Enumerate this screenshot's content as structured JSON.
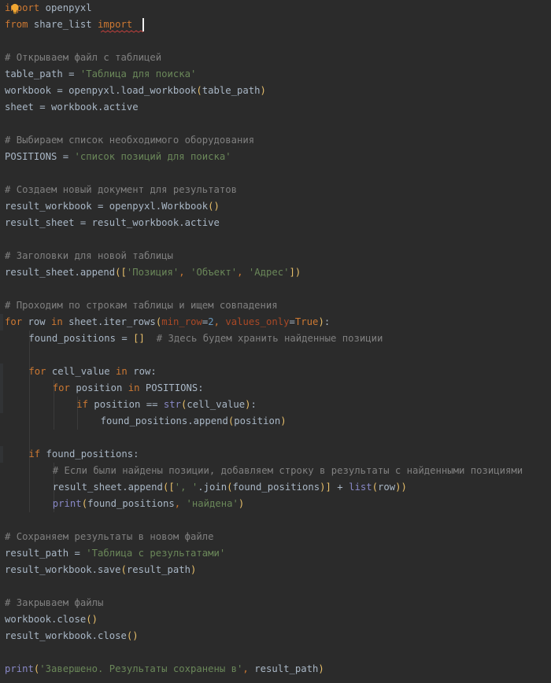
{
  "colors": {
    "background": "#2B2B2B",
    "default": "#A9B7C6",
    "keyword": "#CC7832",
    "string": "#6A8759",
    "comment": "#808080",
    "number": "#6897BB",
    "builtin": "#8888C6",
    "param": "#AA4926",
    "bracket": "#E8BF6A",
    "warning": "#BC3F3C",
    "bulb": "#F0A732"
  },
  "icons": {
    "intention_bulb": "lightbulb-icon"
  },
  "lines": [
    {
      "indent": 0,
      "tokens": [
        {
          "t": "import",
          "k": "keyword"
        },
        {
          "t": " openpyxl",
          "k": "default"
        }
      ]
    },
    {
      "indent": 0,
      "tokens": [
        {
          "t": "from",
          "k": "keyword"
        },
        {
          "t": " share_list ",
          "k": "default"
        },
        {
          "t": "import",
          "k": "keyword"
        }
      ]
    },
    {
      "indent": 0,
      "tokens": []
    },
    {
      "indent": 0,
      "tokens": [
        {
          "t": "# Открываем файл с таблицей",
          "k": "comment"
        }
      ]
    },
    {
      "indent": 0,
      "tokens": [
        {
          "t": "table_path = ",
          "k": "default"
        },
        {
          "t": "'Таблица для поиска'",
          "k": "string"
        }
      ]
    },
    {
      "indent": 0,
      "tokens": [
        {
          "t": "workbook = openpyxl.load_workbook",
          "k": "default"
        },
        {
          "t": "(",
          "k": "bracket"
        },
        {
          "t": "table_path",
          "k": "default"
        },
        {
          "t": ")",
          "k": "bracket"
        }
      ]
    },
    {
      "indent": 0,
      "tokens": [
        {
          "t": "sheet = workbook.active",
          "k": "default"
        }
      ]
    },
    {
      "indent": 0,
      "tokens": []
    },
    {
      "indent": 0,
      "tokens": [
        {
          "t": "# Выбираем список необходимого оборудования",
          "k": "comment"
        }
      ]
    },
    {
      "indent": 0,
      "tokens": [
        {
          "t": "POSITIONS = ",
          "k": "default"
        },
        {
          "t": "'список позиций для поиска'",
          "k": "string"
        }
      ]
    },
    {
      "indent": 0,
      "tokens": []
    },
    {
      "indent": 0,
      "tokens": [
        {
          "t": "# Создаем новый документ для результатов",
          "k": "comment"
        }
      ]
    },
    {
      "indent": 0,
      "tokens": [
        {
          "t": "result_workbook = openpyxl.Workbook",
          "k": "default"
        },
        {
          "t": "()",
          "k": "bracket"
        }
      ]
    },
    {
      "indent": 0,
      "tokens": [
        {
          "t": "result_sheet = result_workbook.active",
          "k": "default"
        }
      ]
    },
    {
      "indent": 0,
      "tokens": []
    },
    {
      "indent": 0,
      "tokens": [
        {
          "t": "# Заголовки для новой таблицы",
          "k": "comment"
        }
      ]
    },
    {
      "indent": 0,
      "tokens": [
        {
          "t": "result_sheet.append",
          "k": "default"
        },
        {
          "t": "([",
          "k": "bracket"
        },
        {
          "t": "'Позиция'",
          "k": "string"
        },
        {
          "t": ", ",
          "k": "keyword"
        },
        {
          "t": "'Объект'",
          "k": "string"
        },
        {
          "t": ", ",
          "k": "keyword"
        },
        {
          "t": "'Адрес'",
          "k": "string"
        },
        {
          "t": "])",
          "k": "bracket"
        }
      ]
    },
    {
      "indent": 0,
      "tokens": []
    },
    {
      "indent": 0,
      "tokens": [
        {
          "t": "# Проходим по строкам таблицы и ищем совпадения",
          "k": "comment"
        }
      ]
    },
    {
      "indent": 0,
      "tokens": [
        {
          "t": "for",
          "k": "keyword"
        },
        {
          "t": " row ",
          "k": "default"
        },
        {
          "t": "in",
          "k": "keyword"
        },
        {
          "t": " sheet.iter_rows",
          "k": "default"
        },
        {
          "t": "(",
          "k": "bracket"
        },
        {
          "t": "min_row",
          "k": "param"
        },
        {
          "t": "=",
          "k": "default"
        },
        {
          "t": "2",
          "k": "number"
        },
        {
          "t": ", ",
          "k": "keyword"
        },
        {
          "t": "values_only",
          "k": "param"
        },
        {
          "t": "=",
          "k": "default"
        },
        {
          "t": "True",
          "k": "keyword"
        },
        {
          "t": ")",
          "k": "bracket"
        },
        {
          "t": ":",
          "k": "default"
        }
      ]
    },
    {
      "indent": 1,
      "tokens": [
        {
          "t": "found_positions = ",
          "k": "default"
        },
        {
          "t": "[]",
          "k": "bracket"
        },
        {
          "t": "  ",
          "k": "default"
        },
        {
          "t": "# Здесь будем хранить найденные позиции",
          "k": "comment"
        }
      ]
    },
    {
      "indent": 0,
      "tokens": []
    },
    {
      "indent": 1,
      "tokens": [
        {
          "t": "for",
          "k": "keyword"
        },
        {
          "t": " cell_value ",
          "k": "default"
        },
        {
          "t": "in",
          "k": "keyword"
        },
        {
          "t": " row:",
          "k": "default"
        }
      ]
    },
    {
      "indent": 2,
      "tokens": [
        {
          "t": "for",
          "k": "keyword"
        },
        {
          "t": " position ",
          "k": "default"
        },
        {
          "t": "in",
          "k": "keyword"
        },
        {
          "t": " POSITIONS:",
          "k": "default"
        }
      ]
    },
    {
      "indent": 3,
      "tokens": [
        {
          "t": "if",
          "k": "keyword"
        },
        {
          "t": " position == ",
          "k": "default"
        },
        {
          "t": "str",
          "k": "builtin"
        },
        {
          "t": "(",
          "k": "bracket"
        },
        {
          "t": "cell_value",
          "k": "default"
        },
        {
          "t": ")",
          "k": "bracket"
        },
        {
          "t": ":",
          "k": "default"
        }
      ]
    },
    {
      "indent": 4,
      "tokens": [
        {
          "t": "found_positions.append",
          "k": "default"
        },
        {
          "t": "(",
          "k": "bracket"
        },
        {
          "t": "position",
          "k": "default"
        },
        {
          "t": ")",
          "k": "bracket"
        }
      ]
    },
    {
      "indent": 0,
      "tokens": []
    },
    {
      "indent": 1,
      "tokens": [
        {
          "t": "if",
          "k": "keyword"
        },
        {
          "t": " found_positions:",
          "k": "default"
        }
      ]
    },
    {
      "indent": 2,
      "tokens": [
        {
          "t": "# Если были найдены позиции, добавляем строку в результаты с найденными позициями",
          "k": "comment"
        }
      ]
    },
    {
      "indent": 2,
      "tokens": [
        {
          "t": "result_sheet.append",
          "k": "default"
        },
        {
          "t": "([",
          "k": "bracket"
        },
        {
          "t": "', '",
          "k": "string"
        },
        {
          "t": ".join",
          "k": "default"
        },
        {
          "t": "(",
          "k": "bracket"
        },
        {
          "t": "found_positions",
          "k": "default"
        },
        {
          "t": ")",
          "k": "bracket"
        },
        {
          "t": "]",
          "k": "bracket"
        },
        {
          "t": " + ",
          "k": "default"
        },
        {
          "t": "list",
          "k": "builtin"
        },
        {
          "t": "(",
          "k": "bracket"
        },
        {
          "t": "row",
          "k": "default"
        },
        {
          "t": "))",
          "k": "bracket"
        }
      ]
    },
    {
      "indent": 2,
      "tokens": [
        {
          "t": "print",
          "k": "builtin"
        },
        {
          "t": "(",
          "k": "bracket"
        },
        {
          "t": "found_positions",
          "k": "default"
        },
        {
          "t": ", ",
          "k": "keyword"
        },
        {
          "t": "'найдена'",
          "k": "string"
        },
        {
          "t": ")",
          "k": "bracket"
        }
      ]
    },
    {
      "indent": 0,
      "tokens": []
    },
    {
      "indent": 0,
      "tokens": [
        {
          "t": "# Сохраняем результаты в новом файле",
          "k": "comment"
        }
      ]
    },
    {
      "indent": 0,
      "tokens": [
        {
          "t": "result_path = ",
          "k": "default"
        },
        {
          "t": "'Таблица с результатами'",
          "k": "string"
        }
      ]
    },
    {
      "indent": 0,
      "tokens": [
        {
          "t": "result_workbook.save",
          "k": "default"
        },
        {
          "t": "(",
          "k": "bracket"
        },
        {
          "t": "result_path",
          "k": "default"
        },
        {
          "t": ")",
          "k": "bracket"
        }
      ]
    },
    {
      "indent": 0,
      "tokens": []
    },
    {
      "indent": 0,
      "tokens": [
        {
          "t": "# Закрываем файлы",
          "k": "comment"
        }
      ]
    },
    {
      "indent": 0,
      "tokens": [
        {
          "t": "workbook.close",
          "k": "default"
        },
        {
          "t": "()",
          "k": "bracket"
        }
      ]
    },
    {
      "indent": 0,
      "tokens": [
        {
          "t": "result_workbook.close",
          "k": "default"
        },
        {
          "t": "()",
          "k": "bracket"
        }
      ]
    },
    {
      "indent": 0,
      "tokens": []
    },
    {
      "indent": 0,
      "tokens": [
        {
          "t": "print",
          "k": "builtin"
        },
        {
          "t": "(",
          "k": "bracket"
        },
        {
          "t": "'Завершено. Результаты сохранены в'",
          "k": "string"
        },
        {
          "t": ", ",
          "k": "keyword"
        },
        {
          "t": "result_path",
          "k": "default"
        },
        {
          "t": ")",
          "k": "bracket"
        }
      ]
    }
  ]
}
